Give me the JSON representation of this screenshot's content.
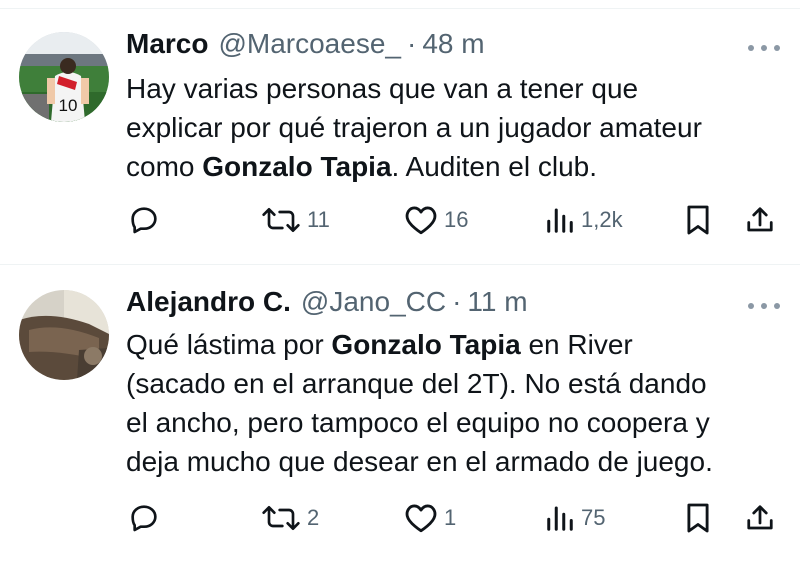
{
  "tweets": [
    {
      "name": "Marco",
      "handle": "@Marcoaese_",
      "sep": "·",
      "time": "48 m",
      "body_lines": [
        [
          "Hay varias personas que van a tener que"
        ],
        [
          "explicar por qué trajeron a un jugador amateur"
        ]
      ],
      "line3_pre": "como ",
      "line3_bold": "Gonzalo Tapia",
      "line3_post": ". Auditen el club.",
      "replies": "",
      "retweets": "11",
      "likes": "16",
      "views": "1,2k"
    },
    {
      "name": "Alejandro C.",
      "handle": "@Jano_CC",
      "sep": "·",
      "time": "11 m",
      "line1_pre": "Qué lástima por ",
      "line1_bold": "Gonzalo Tapia",
      "line1_post": " en River",
      "line2": "(sacado en el arranque del 2T). No está dando",
      "line3": "el ancho, pero tampoco el equipo no coopera y",
      "line4": "deja mucho que desear en el armado de juego.",
      "replies": "",
      "retweets": "2",
      "likes": "1",
      "views": "75"
    }
  ],
  "icons": {
    "reply": "reply-icon",
    "retweet": "retweet-icon",
    "like": "heart-icon",
    "views": "views-icon",
    "bookmark": "bookmark-icon",
    "share": "share-icon",
    "more": "more-icon"
  },
  "colors": {
    "text": "#0f1419",
    "secondary": "#536471",
    "separator": "#eff3f4"
  }
}
